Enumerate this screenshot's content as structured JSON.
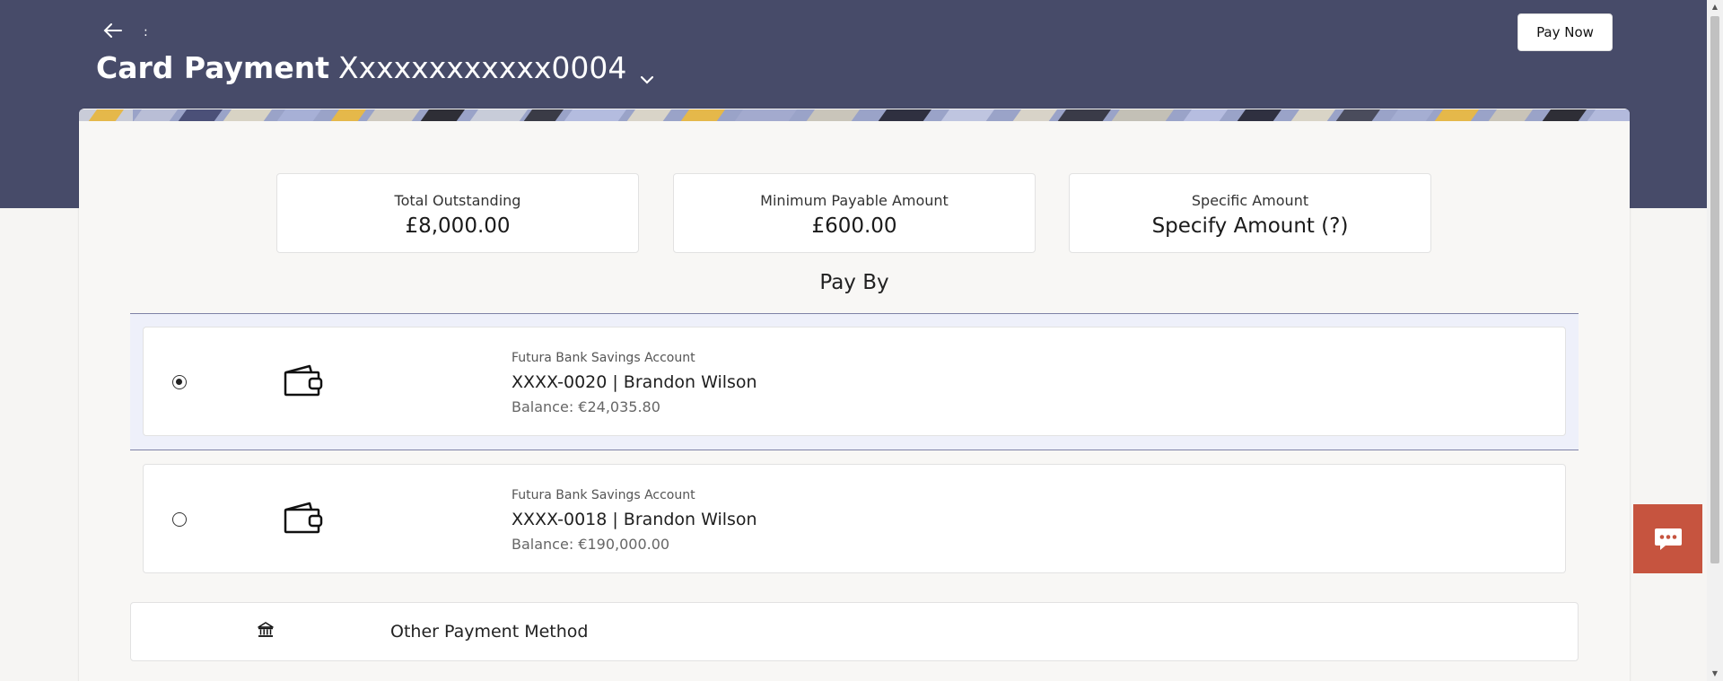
{
  "header": {
    "back_icon": "arrow-left-icon",
    "separator": ":",
    "title_bold": "Card Payment",
    "title_card": "Xxxxxxxxxxxx0004",
    "dropdown_icon": "chevron-down-icon",
    "pay_now_label": "Pay Now",
    "band_color": "#474b69"
  },
  "amount_options": [
    {
      "label": "Total Outstanding",
      "value": "£8,000.00"
    },
    {
      "label": "Minimum Payable Amount",
      "value": "£600.00"
    },
    {
      "label": "Specific Amount",
      "value": "Specify Amount (?)"
    }
  ],
  "pay_by": {
    "title": "Pay By",
    "accounts": [
      {
        "selected": true,
        "icon": "wallet-icon",
        "type": "Futura Bank Savings Account",
        "number": "XXXX-0020 | Brandon Wilson",
        "balance": "Balance: €24,035.80"
      },
      {
        "selected": false,
        "icon": "wallet-icon",
        "type": "Futura Bank Savings Account",
        "number": "XXXX-0018 | Brandon Wilson",
        "balance": "Balance: €190,000.00"
      }
    ],
    "other": {
      "icon": "bank-icon",
      "label": "Other Payment Method"
    }
  },
  "chat": {
    "icon": "chat-bubble-icon",
    "color": "#c6543f"
  }
}
